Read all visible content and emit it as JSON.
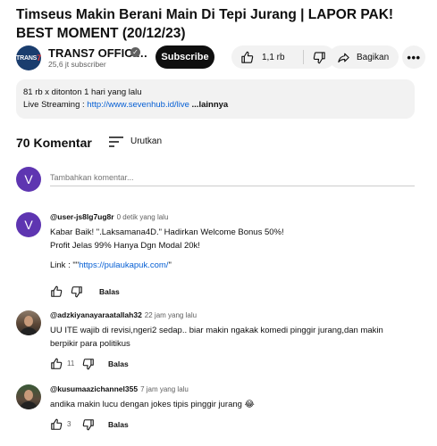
{
  "video": {
    "title": "Timseus Makin Berani Main Di Tepi Jurang | LAPOR PAK! BEST MOMENT (20/12/23)"
  },
  "channel": {
    "logo_text_a": "TRANS",
    "logo_text_b": "7",
    "name": "TRANS7 OFFICI…",
    "subscribers": "25,6 jt subscriber",
    "subscribe_label": "Subscribe"
  },
  "actions": {
    "like_count": "1,1 rb",
    "share_label": "Bagikan",
    "more_label": "•••"
  },
  "description": {
    "stats": "81 rb x ditonton  1 hari yang lalu",
    "line2_prefix": "Live Streaming : ",
    "line2_link": "http://www.sevenhub.id/live",
    "more": " ...lainnya"
  },
  "comments_section": {
    "count_label": "70 Komentar",
    "sort_label": "Urutkan",
    "add_placeholder": "Tambahkan komentar...",
    "me_initial": "V"
  },
  "comments": [
    {
      "avatar_initial": "V",
      "author": "@user-js8lg7ug8r",
      "time": "0 detik yang lalu",
      "line1": "Kabar Baik! \".Laksamana4D.\" Hadirkan Welcome Bonus 50%!",
      "line2": "Profit Jelas 99% Hanya Dgn Modal 20k!",
      "line3_prefix": "Link  : \"\"",
      "line3_link": "https://pulaukapuk.com/",
      "line3_suffix": "\"",
      "like_count": "",
      "reply": "Balas"
    },
    {
      "author": "@adzkiyanayaraatallah32",
      "time": "22 jam yang lalu",
      "line1": "UU ITE wajib di revisi,ngeri2 sedap.. biar makin ngakak komedi pinggir jurang,dan makin",
      "line2": "berpikir para politikus",
      "like_count": "11",
      "reply": "Balas"
    },
    {
      "author": "@kusumaazichannel355",
      "time": "7 jam yang lalu",
      "line1": "andika makin lucu dengan jokes tipis pinggir jurang 😂",
      "like_count": "3",
      "reply": "Balas"
    }
  ],
  "icons": {
    "like": "thumbs-up-icon",
    "dislike": "thumbs-down-icon",
    "share": "share-arrow-icon",
    "sort": "sort-lines-icon",
    "verified": "verified-check-icon"
  },
  "colors": {
    "link": "#065fd4",
    "subscribe_bg": "#0f0f0f",
    "pill_bg": "#f2f2f2",
    "avatar_purple": "#5e35b1",
    "secondary_text": "#606060"
  }
}
